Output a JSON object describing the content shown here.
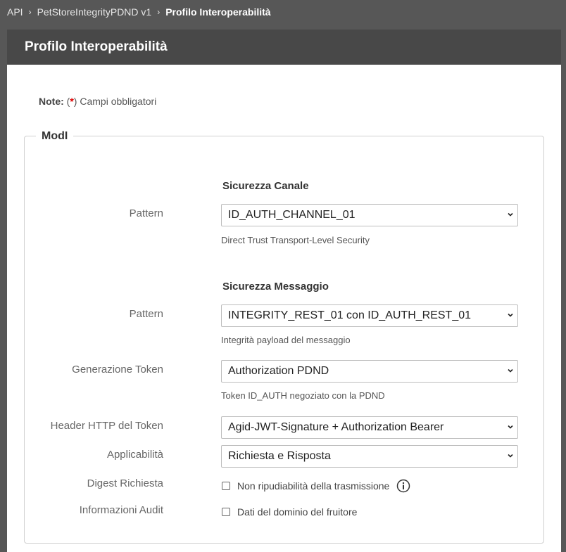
{
  "breadcrumb": {
    "items": [
      "API",
      "PetStoreIntegrityPDND v1"
    ],
    "current": "Profilo Interoperabilità",
    "separator": "›"
  },
  "panel": {
    "title": "Profilo Interoperabilità"
  },
  "note": {
    "prefix": "Note:",
    "open": "(",
    "asterisk": "*",
    "rest": ") Campi obbligatori"
  },
  "fieldset": {
    "legend": "ModI"
  },
  "sicurezza_canale": {
    "title": "Sicurezza Canale",
    "pattern_label": "Pattern",
    "pattern_value": "ID_AUTH_CHANNEL_01",
    "pattern_help": "Direct Trust Transport-Level Security"
  },
  "sicurezza_messaggio": {
    "title": "Sicurezza Messaggio",
    "pattern_label": "Pattern",
    "pattern_value": "INTEGRITY_REST_01 con ID_AUTH_REST_01",
    "pattern_help": "Integrità payload del messaggio",
    "token_label": "Generazione Token",
    "token_value": "Authorization PDND",
    "token_help": "Token ID_AUTH negoziato con la PDND",
    "header_label": "Header HTTP del Token",
    "header_value": "Agid-JWT-Signature + Authorization Bearer",
    "applicabilita_label": "Applicabilità",
    "applicabilita_value": "Richiesta e Risposta",
    "digest_label": "Digest Richiesta",
    "digest_option": "Non ripudiabilità della trasmissione",
    "audit_label": "Informazioni Audit",
    "audit_option": "Dati del dominio del fruitore"
  }
}
